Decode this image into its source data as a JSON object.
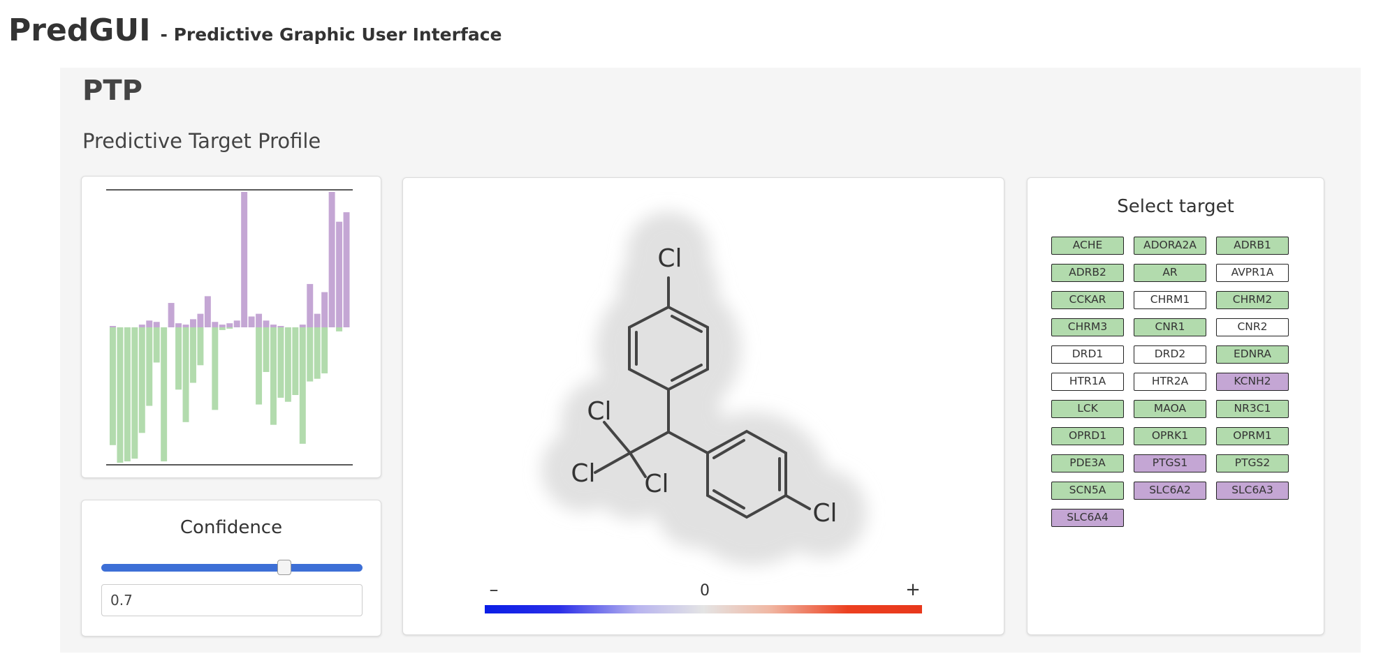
{
  "header": {
    "title": "PredGUI",
    "subtitle": "- Predictive Graphic User Interface"
  },
  "section": {
    "title": "PTP",
    "subtitle": "Predictive Target Profile"
  },
  "colors": {
    "positive": "#c4a6d4",
    "negative": "#b2dbad",
    "neutral": "#ffffff",
    "slider": "#3d6fd6"
  },
  "chart_data": {
    "type": "bar",
    "ylim": [
      -1,
      1
    ],
    "values": [
      -0.87,
      -1.0,
      -0.99,
      -0.97,
      0.02,
      0.05,
      0.04,
      -0.27,
      0.18,
      0.03,
      0.02,
      0.06,
      0.1,
      0.23,
      0.04,
      0.02,
      0.03,
      0.05,
      0.7,
      0.08,
      0.1,
      0.05,
      -0.72,
      -0.52,
      -0.55,
      -0.5,
      -0.86,
      -0.4,
      0.32,
      0.1,
      0.67,
      0.57,
      0.62
    ],
    "neg_segments": [
      [
        0,
        -0.87
      ],
      [
        1,
        -1.0
      ],
      [
        2,
        -0.99
      ],
      [
        3,
        -0.97
      ],
      [
        4,
        -0.78
      ],
      [
        5,
        -0.58
      ],
      [
        6,
        -0.26
      ],
      [
        7,
        -0.99
      ],
      [
        9,
        -0.46
      ],
      [
        10,
        -0.7
      ],
      [
        11,
        -0.41
      ],
      [
        12,
        -0.28
      ],
      [
        14,
        -0.61
      ],
      [
        15,
        -0.02
      ],
      [
        16,
        -0.01
      ],
      [
        20,
        -0.57
      ],
      [
        21,
        -0.33
      ],
      [
        22,
        -0.72
      ],
      [
        23,
        -0.52
      ],
      [
        24,
        -0.55
      ],
      [
        25,
        -0.5
      ],
      [
        26,
        -0.86
      ],
      [
        27,
        -0.4
      ],
      [
        28,
        -0.38
      ],
      [
        29,
        -0.34
      ],
      [
        31,
        -0.03
      ]
    ],
    "pos_segments": [
      [
        0,
        0.01
      ],
      [
        4,
        0.02
      ],
      [
        5,
        0.05
      ],
      [
        6,
        0.04
      ],
      [
        8,
        0.18
      ],
      [
        9,
        0.03
      ],
      [
        10,
        0.02
      ],
      [
        11,
        0.06
      ],
      [
        12,
        0.1
      ],
      [
        13,
        0.23
      ],
      [
        14,
        0.04
      ],
      [
        15,
        0.02
      ],
      [
        16,
        0.03
      ],
      [
        17,
        0.05
      ],
      [
        18,
        1.0
      ],
      [
        19,
        0.08
      ],
      [
        20,
        0.1
      ],
      [
        21,
        0.05
      ],
      [
        22,
        0.02
      ],
      [
        23,
        0.01
      ],
      [
        26,
        0.02
      ],
      [
        27,
        0.32
      ],
      [
        28,
        0.1
      ],
      [
        29,
        0.26
      ],
      [
        30,
        1.0
      ],
      [
        31,
        0.78
      ],
      [
        32,
        0.85
      ]
    ]
  },
  "molecule": {
    "atoms": [
      "Cl",
      "Cl",
      "Cl",
      "Cl",
      "Cl"
    ],
    "colorbar": {
      "min_label": "–",
      "mid_label": "0",
      "max_label": "+"
    }
  },
  "confidence": {
    "label": "Confidence",
    "value": "0.7",
    "level": 0.7
  },
  "targets": {
    "title": "Select target",
    "items": [
      {
        "name": "ACHE",
        "state": "green"
      },
      {
        "name": "ADORA2A",
        "state": "green"
      },
      {
        "name": "ADRB1",
        "state": "green"
      },
      {
        "name": "ADRB2",
        "state": "green"
      },
      {
        "name": "AR",
        "state": "green"
      },
      {
        "name": "AVPR1A",
        "state": "white"
      },
      {
        "name": "CCKAR",
        "state": "green"
      },
      {
        "name": "CHRM1",
        "state": "white"
      },
      {
        "name": "CHRM2",
        "state": "green"
      },
      {
        "name": "CHRM3",
        "state": "green"
      },
      {
        "name": "CNR1",
        "state": "green"
      },
      {
        "name": "CNR2",
        "state": "white"
      },
      {
        "name": "DRD1",
        "state": "white"
      },
      {
        "name": "DRD2",
        "state": "white"
      },
      {
        "name": "EDNRA",
        "state": "green"
      },
      {
        "name": "HTR1A",
        "state": "white"
      },
      {
        "name": "HTR2A",
        "state": "white"
      },
      {
        "name": "KCNH2",
        "state": "purple"
      },
      {
        "name": "LCK",
        "state": "green"
      },
      {
        "name": "MAOA",
        "state": "green"
      },
      {
        "name": "NR3C1",
        "state": "green"
      },
      {
        "name": "OPRD1",
        "state": "green"
      },
      {
        "name": "OPRK1",
        "state": "green"
      },
      {
        "name": "OPRM1",
        "state": "green"
      },
      {
        "name": "PDE3A",
        "state": "green"
      },
      {
        "name": "PTGS1",
        "state": "purple"
      },
      {
        "name": "PTGS2",
        "state": "green"
      },
      {
        "name": "SCN5A",
        "state": "green"
      },
      {
        "name": "SLC6A2",
        "state": "purple"
      },
      {
        "name": "SLC6A3",
        "state": "purple"
      },
      {
        "name": "SLC6A4",
        "state": "purple"
      }
    ]
  }
}
